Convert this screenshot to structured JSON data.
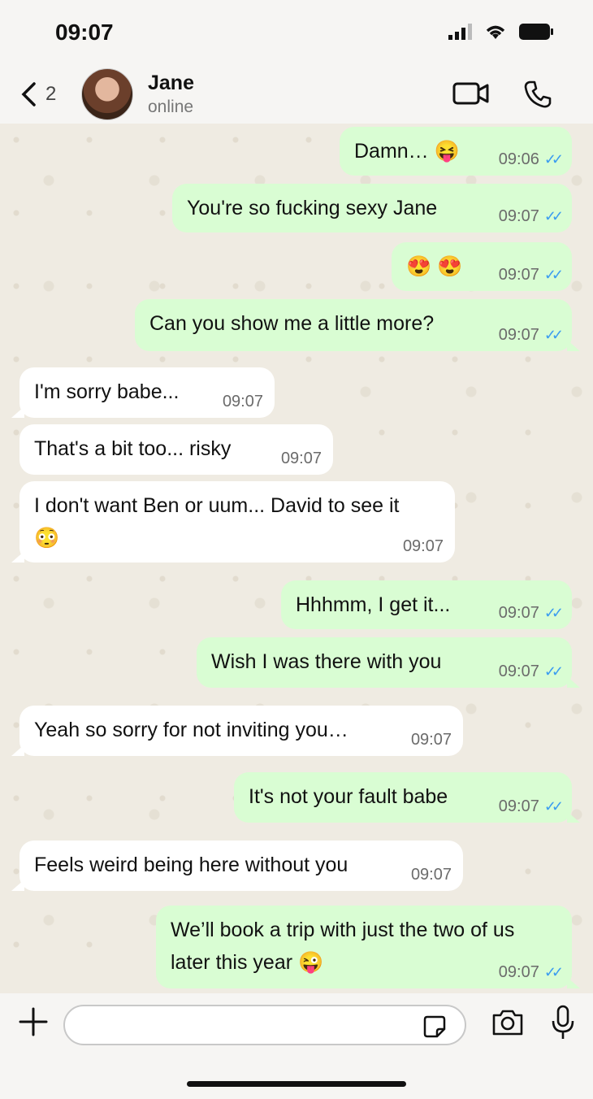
{
  "status_bar": {
    "time": "09:07"
  },
  "header": {
    "back_count": "2",
    "name": "Jane",
    "status": "online"
  },
  "messages": [
    {
      "dir": "out",
      "text": "Damn…",
      "emoji": "😝",
      "time": "09:06"
    },
    {
      "dir": "out",
      "text": "You're so fucking sexy Jane",
      "time": "09:07"
    },
    {
      "dir": "out",
      "text": "",
      "emoji": "😍 😍",
      "time": "09:07"
    },
    {
      "dir": "out",
      "text": "Can you show me a little more?",
      "time": "09:07"
    },
    {
      "dir": "in",
      "text": "I'm sorry babe...",
      "time": "09:07"
    },
    {
      "dir": "in",
      "text": "That's a bit too... risky",
      "time": "09:07"
    },
    {
      "dir": "in",
      "text": "I don't want Ben or uum... David to see it",
      "emoji": "😳",
      "time": "09:07"
    },
    {
      "dir": "out",
      "text": "Hhhmm, I get it...",
      "time": "09:07"
    },
    {
      "dir": "out",
      "text": "Wish I was there with you",
      "time": "09:07"
    },
    {
      "dir": "in",
      "text": "Yeah so sorry for not inviting you…",
      "time": "09:07"
    },
    {
      "dir": "out",
      "text": "It's not your fault babe",
      "time": "09:07"
    },
    {
      "dir": "in",
      "text": "Feels weird being here without you",
      "time": "09:07"
    },
    {
      "dir": "out",
      "text": "We’ll book a trip with just the two of us",
      "text2": "later this year",
      "emoji": "😜",
      "time": "09:07"
    }
  ],
  "composer": {
    "value": "",
    "placeholder": ""
  },
  "colors": {
    "outgoing": "#d9fdd3",
    "incoming": "#ffffff",
    "ticks": "#3b9cf0",
    "background": "#efebe2"
  }
}
